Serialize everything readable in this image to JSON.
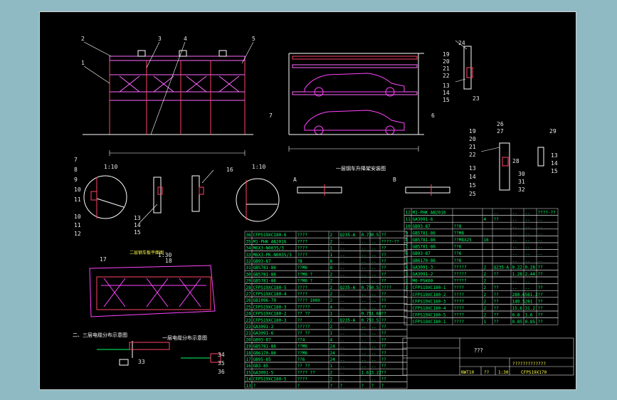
{
  "balloons_main": [
    "2",
    "3",
    "4",
    "5",
    "1",
    "6",
    "7"
  ],
  "balloons_left": [
    "7",
    "8",
    "9",
    "10",
    "11",
    "10",
    "11",
    "12"
  ],
  "balloons_mid": [
    "13",
    "14",
    "15",
    "16",
    "17",
    "18"
  ],
  "balloons_right_top": [
    "19",
    "20",
    "21",
    "22",
    "24",
    "13",
    "14",
    "15",
    "23"
  ],
  "balloons_right_mid": [
    "19",
    "20",
    "21",
    "22",
    "13",
    "14",
    "15",
    "25",
    "26",
    "27",
    "28",
    "29",
    "30",
    "31",
    "32",
    "13",
    "14",
    "15"
  ],
  "balloons_bottom": [
    "33",
    "34",
    "35",
    "36"
  ],
  "scale_labels": {
    "detail_a": "1:10",
    "detail_b": "1:10",
    "plan": "1:30"
  },
  "views": {
    "a_label": "A",
    "b_label": "B"
  },
  "captions": {
    "front_view": "一层钢车升降架安装图",
    "upper_plan": "二层钢车板平面图",
    "floor_2_3": "二、三层电缆分布示意图",
    "floor_1": "一层电缆分布示意图"
  },
  "parts_left": [
    [
      "36",
      "CFPS19XC180-6",
      "????",
      "2",
      "Q235-A",
      "0.73",
      "0.5",
      "??"
    ],
    [
      "35",
      "M1-PHK AB2016",
      "????",
      "2",
      "..",
      "..",
      "..",
      "????-??"
    ],
    [
      "34",
      "M6X3-N0035/3",
      "????",
      "1",
      "..",
      "..",
      "..",
      "??"
    ],
    [
      "33",
      "M6X3-PK-N0035/3",
      "????",
      "1",
      "..",
      "..",
      "..",
      "??"
    ],
    [
      "32",
      "GB93-87",
      "?8",
      "8",
      "..",
      "..",
      "..",
      "??"
    ],
    [
      "31",
      "GB5781-86",
      "??M6",
      "8",
      "..",
      "..",
      "..",
      "??"
    ],
    [
      "30",
      "GB5781-86",
      "??M6 ?",
      "2",
      "..",
      "..",
      "..",
      "??"
    ],
    [
      "29",
      "GB5781-86",
      "??M6 ?",
      "2",
      "..",
      "..",
      "..",
      "??"
    ],
    [
      "28",
      "CFPS19XC180-5",
      "????",
      "2",
      "Q235-A",
      "0.75",
      "0.5",
      "????"
    ],
    [
      "27",
      "CFPS19XC180-4",
      "????",
      "2",
      "..",
      "..",
      "..",
      "??"
    ],
    [
      "26",
      "GB1096-79",
      "???? 100X",
      "2",
      "..",
      "..",
      "..",
      "??"
    ],
    [
      "25",
      "CFPS19XC180-3",
      "?????",
      "4",
      "..",
      "..",
      "..",
      "??"
    ],
    [
      "24",
      "CFPS19XC180-2",
      "?? ??",
      "1",
      "..",
      "0.75",
      "1.68",
      "??"
    ],
    [
      "23",
      "CFPS19XC180-3",
      "??",
      "2",
      "Q235-A",
      "0.75",
      "3.5",
      "??"
    ],
    [
      "22",
      "GA3091-2",
      "?????",
      "2",
      "..",
      "..",
      "..",
      "??"
    ],
    [
      "21",
      "GA3091-6",
      "?? ??",
      "1",
      "..",
      "..",
      "..",
      "??"
    ],
    [
      "20",
      "GB93-87",
      "??4",
      "4",
      "..",
      "..",
      "..",
      "??"
    ],
    [
      "19",
      "GB5781-86",
      "??M6",
      "24",
      "..",
      "..",
      "..",
      "??"
    ],
    [
      "18",
      "GB6170-86",
      "??M6",
      "24",
      "..",
      "..",
      "..",
      "??"
    ],
    [
      "17",
      "GB95-85",
      "??6",
      "24",
      "..",
      "..",
      "..",
      "??"
    ],
    [
      "16",
      "GB3-85",
      "?? ??",
      "1",
      "..",
      "..",
      "..",
      "??"
    ],
    [
      "15",
      "GA3091-5",
      "???? ??",
      "2",
      "..",
      "1.61",
      "3.22",
      "??"
    ],
    [
      "14",
      "CFPS19XC180-5",
      "????",
      "2",
      "..",
      "..",
      "..",
      "??"
    ],
    [
      "13",
      "?",
      "?",
      "?",
      "?",
      "?",
      "?",
      "?"
    ]
  ],
  "parts_right": [
    [
      "12",
      "M1-PHK AB2016",
      "",
      "",
      "..",
      "..",
      "..",
      "????-??"
    ],
    [
      "11",
      "GA3091-6",
      "",
      "4",
      "??",
      "..",
      "..",
      ".."
    ],
    [
      "10",
      "GB93-87",
      "??8",
      "",
      "",
      "..",
      "..",
      ".."
    ],
    [
      "9",
      "GB5781-86",
      "??M8",
      "",
      "",
      "..",
      "..",
      ".."
    ],
    [
      "8",
      "GB5781-86",
      "??M8X25",
      "16",
      "",
      "..",
      "..",
      ".."
    ],
    [
      "7",
      "GB5781-86",
      "??6",
      "",
      "",
      "..",
      "..",
      ".."
    ],
    [
      "6",
      "GB93-87",
      "??6",
      "",
      "",
      "..",
      "..",
      ".."
    ],
    [
      "5",
      "GB6170-86",
      "??6",
      "",
      "",
      "..",
      "..",
      ".."
    ],
    [
      "4",
      "GA3091-3",
      "?????",
      "2",
      "Q235-A",
      "0.22",
      "0.28",
      "??"
    ],
    [
      "3",
      "GA3091-2",
      "?????",
      "2",
      "??",
      "1.28",
      "2.44",
      "??"
    ],
    [
      "2",
      "M6-PSK60",
      "?????",
      "2",
      "",
      "..",
      "..",
      ".."
    ],
    [
      "1",
      "CFPS19XC180-1",
      "????",
      "2",
      "??",
      "..",
      "..",
      "??"
    ],
    [
      "",
      "CFPS19XC180-2",
      "????",
      "2",
      "??",
      "280.6",
      "561.2",
      "??"
    ],
    [
      "",
      "CFPS19XC180-3",
      "????",
      "2",
      "??",
      "140.5",
      "281",
      "??"
    ],
    [
      "",
      "CFPS19XC180-4",
      "????",
      "2",
      "??",
      "15.6",
      "31.2",
      "??"
    ],
    [
      "",
      "CFPS19XC180-5",
      "????",
      "2",
      "??",
      "0.8",
      "1.6",
      "??"
    ],
    [
      "",
      "CFPS19XC180-1",
      "????",
      "1",
      "??",
      "0.85",
      "0.85",
      "??"
    ]
  ],
  "title_block": {
    "big_label": "???",
    "subtitle": "?????????????",
    "drawing_no": "CFPS19X170",
    "scale": "1:30",
    "weight": "NWT10",
    "sheet": "??"
  }
}
